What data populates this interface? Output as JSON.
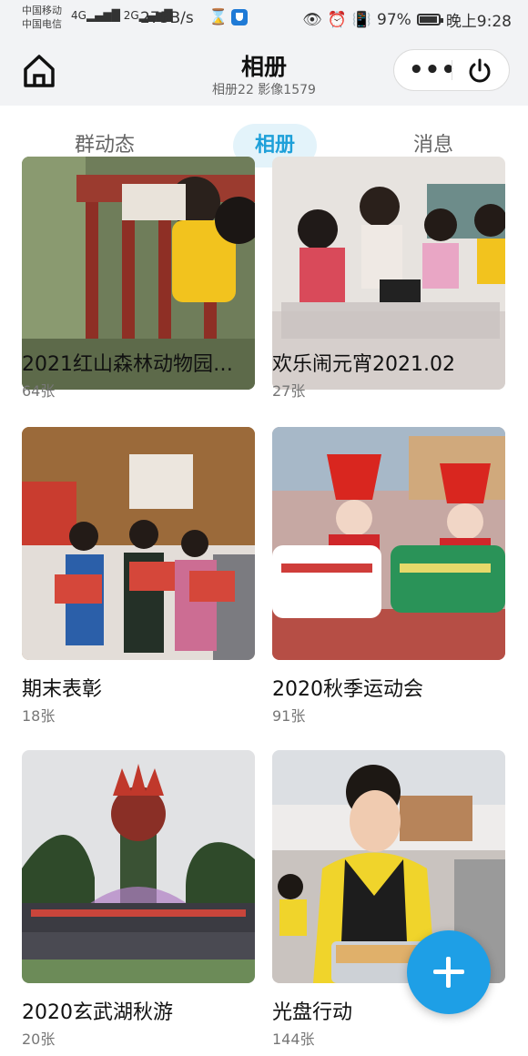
{
  "status_bar": {
    "carrier_1": "中国移动",
    "carrier_2": "中国电信",
    "signal_1": "4G",
    "signal_2": "2G",
    "net_speed": "275B/s",
    "battery_percent": "97%",
    "battery_level": 0.97,
    "time": "晚上9:28"
  },
  "header": {
    "title": "相册",
    "subtitle": "相册22 影像1579",
    "more_label": "•••"
  },
  "tabs": [
    {
      "label": "群动态",
      "active": false
    },
    {
      "label": "相册",
      "active": true
    },
    {
      "label": "消息",
      "active": false
    }
  ],
  "albums": [
    {
      "name": "2021红山森林动物园…",
      "count": "64张"
    },
    {
      "name": "欢乐闹元宵2021.02",
      "count": "27张"
    },
    {
      "name": "期末表彰",
      "count": "18张"
    },
    {
      "name": "2020秋季运动会",
      "count": "91张"
    },
    {
      "name": "2020玄武湖秋游",
      "count": "20张"
    },
    {
      "name": "光盘行动",
      "count": "144张"
    }
  ],
  "colors": {
    "accent": "#1ea0d9",
    "fab": "#1e9fe6",
    "header_bg": "#f2f3f5"
  }
}
